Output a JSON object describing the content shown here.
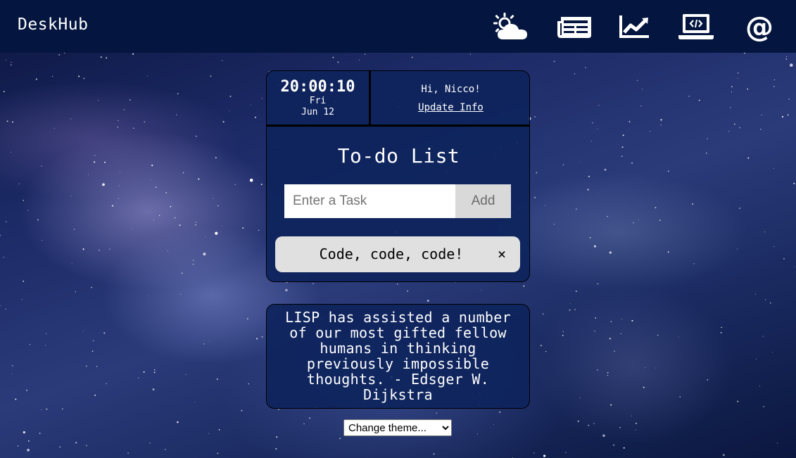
{
  "header": {
    "brand": "DeskHub",
    "nav": [
      {
        "name": "weather",
        "icon": "weather-icon"
      },
      {
        "name": "news",
        "icon": "newspaper-icon"
      },
      {
        "name": "stocks",
        "icon": "chart-line-icon"
      },
      {
        "name": "code",
        "icon": "laptop-code-icon"
      },
      {
        "name": "contact",
        "icon": "at-icon"
      }
    ]
  },
  "clock": {
    "time": "20:00:10",
    "day": "Fri",
    "date": "Jun 12"
  },
  "greeting": {
    "text": "Hi, Nicco!",
    "update_link": "Update Info"
  },
  "todo": {
    "title": "To-do List",
    "input_placeholder": "Enter a Task",
    "input_value": "",
    "add_label": "Add",
    "items": [
      {
        "text": "Code, code, code!",
        "remove": "×"
      }
    ]
  },
  "quote": {
    "text": "LISP has assisted a number of our most gifted fellow humans in thinking previously impossible thoughts. - Edsger W. Dijkstra"
  },
  "theme": {
    "selected": "Change theme..."
  },
  "colors": {
    "header_bg": "#04163f",
    "card_bg": "#0e245c",
    "item_bg": "#e0e0e0",
    "button_bg": "#d9d9d9"
  }
}
